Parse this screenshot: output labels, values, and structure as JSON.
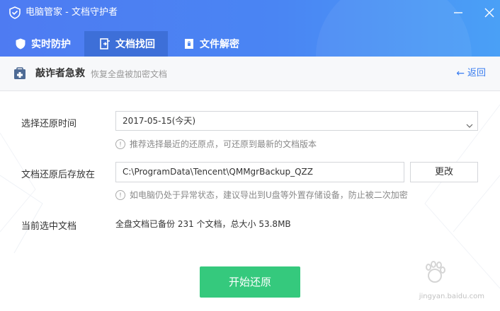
{
  "window": {
    "title": "电脑管家 - 文档守护者",
    "controls": [
      "minimize-icon",
      "close-icon"
    ],
    "accent": "#4a85f3"
  },
  "tabs": [
    {
      "label": "实时防护",
      "icon": "shield-icon",
      "active": false
    },
    {
      "label": "文档找回",
      "icon": "document-restore-icon",
      "active": true
    },
    {
      "label": "文件解密",
      "icon": "lock-file-icon",
      "active": false
    }
  ],
  "subheader": {
    "title": "敲诈者急救",
    "description": "恢复全盘被加密文档",
    "back_label": "返回",
    "icon": "rescue-icon"
  },
  "form": {
    "restore_time": {
      "label": "选择还原时间",
      "value": "2017-05-15(今天)",
      "hint": "推荐选择最近的还原点，可还原到最新的文档版本"
    },
    "save_location": {
      "label": "文档还原后存放在",
      "value": "C:\\ProgramData\\Tencent\\QMMgrBackup_QZZ",
      "change_label": "更改",
      "hint": "如电脑仍处于异常状态，建议导出到U盘等外置存储设备，防止被二次加密"
    },
    "current_docs": {
      "label": "当前选中文档",
      "value": "全盘文档已备份 231 个文档，总大小 53.8MB"
    },
    "start_label": "开始还原",
    "start_color": "#35c97d"
  },
  "watermark": {
    "text": "jingyan.baidu.com"
  }
}
